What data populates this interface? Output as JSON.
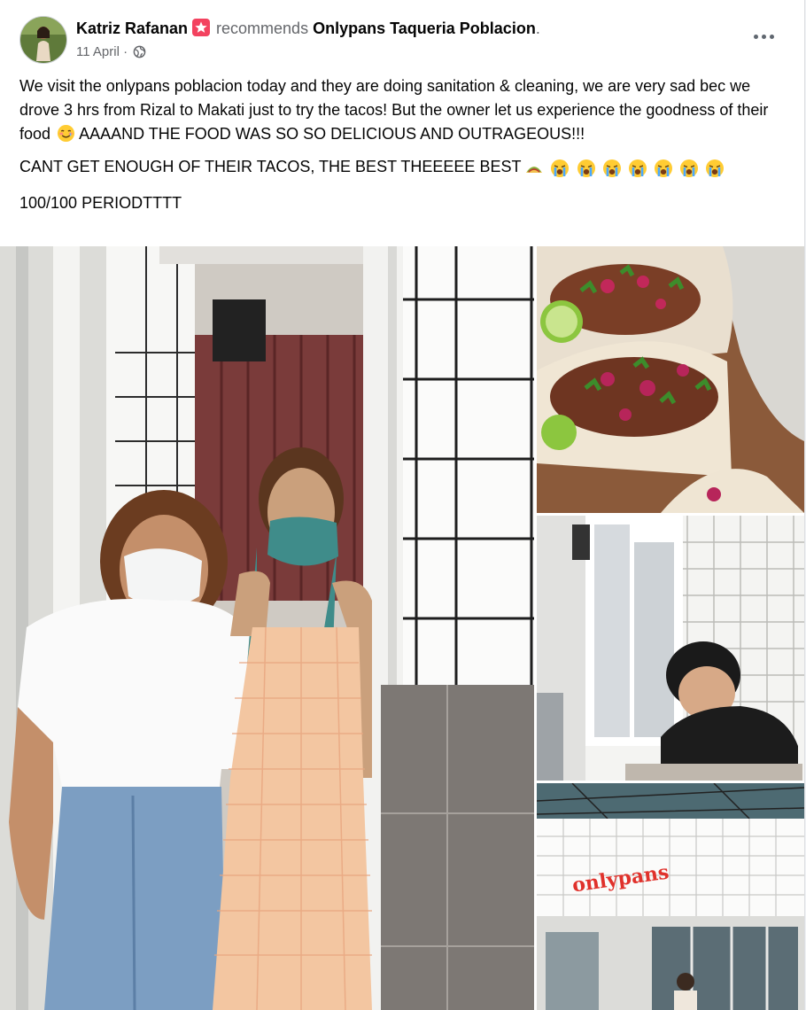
{
  "post": {
    "author": "Katriz Rafanan",
    "action": "recommends",
    "page_name": "Onlypans Taqueria Poblacion",
    "page_suffix": ".",
    "date": "11 April",
    "separator": "·",
    "privacy_icon": "globe-icon",
    "paragraph1_text": "We visit the onlypans poblacion today and they are doing sanitation & cleaning, we are very sad bec we drove 3 hrs from Rizal to Makati just to try the tacos! But the owner let us experience the goodness of their food",
    "paragraph1_emoji": "smiling-face-with-tear-icon",
    "paragraph1_tail": " AAAAND THE FOOD WAS SO SO DELICIOUS AND OUTRAGEOUS!!!",
    "paragraph2_text": "CANT GET ENOUGH OF THEIR TACOS, THE BEST THEEEEE BEST",
    "paragraph2_emojis": [
      "taco-icon",
      "crying-face-icon",
      "crying-face-icon",
      "crying-face-icon",
      "crying-face-icon",
      "crying-face-icon",
      "crying-face-icon",
      "crying-face-icon"
    ],
    "paragraph3_text": "100/100 PERIODTTTT"
  },
  "photos": {
    "sign_text": "onlypans"
  },
  "colors": {
    "secondary_text": "#65676b",
    "badge": "#f3425f",
    "brand_red": "#e0312b"
  }
}
